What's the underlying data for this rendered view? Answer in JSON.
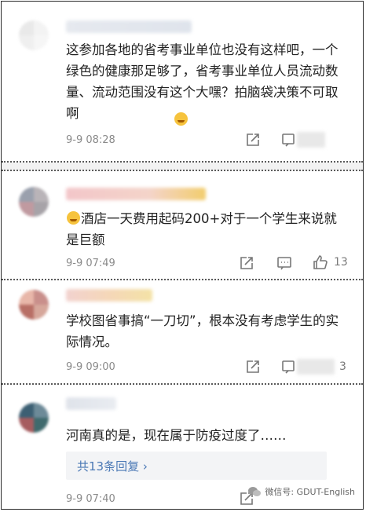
{
  "comments": [
    {
      "text": "这参加各地的省考事业单位也没有这样吧，一个绿色的健康那足够了，省考事业单位人员流动数量、流动范围没有这个大嘿？拍脑袋决策不可取啊",
      "time": "9-9 08:28",
      "likes": ""
    },
    {
      "text": "酒店一天费用起码200+对于一个学生来说就是巨额",
      "time": "9-9 07:49",
      "likes": "13"
    },
    {
      "text": "学校图省事搞“一刀切”，根本没有考虑学生的实际情况。",
      "time": "9-9 09:00",
      "likes": "3"
    },
    {
      "text": "河南真的是，现在属于防疫过度了……",
      "time": "9-9 07:40",
      "likes": ""
    }
  ],
  "replies_label": "共13条回复 ›",
  "watermark": "微信号: GDUT-English",
  "colors": {
    "link": "#4a78b5",
    "muted": "#8a8a8a",
    "text": "#222222"
  }
}
